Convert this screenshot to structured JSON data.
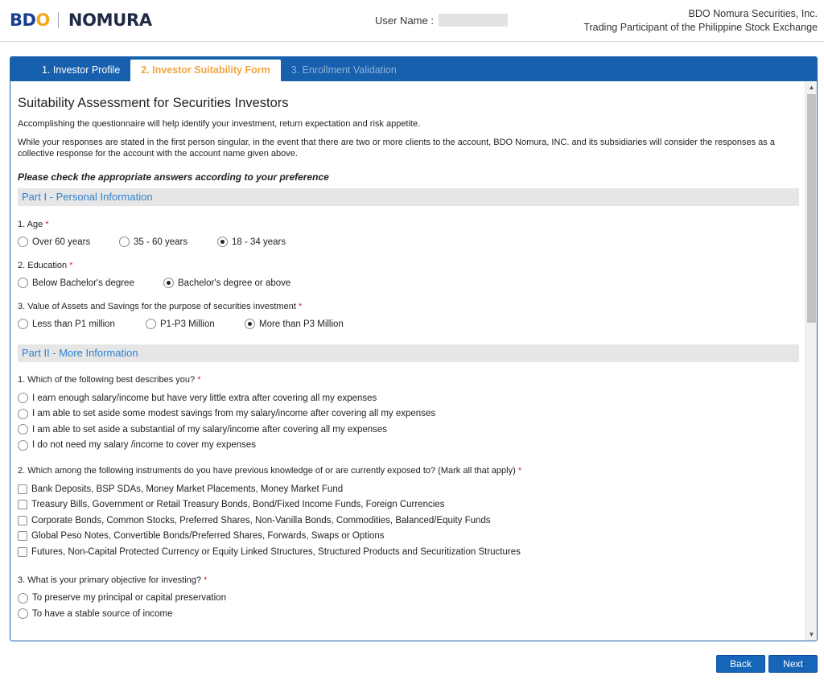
{
  "header": {
    "logo_bdo": "BDO",
    "logo_nomura": "NOMURA",
    "user_label": "User Name :",
    "company_line1": "BDO Nomura Securities, Inc.",
    "company_line2": "Trading Participant of the Philippine Stock Exchange"
  },
  "tabs": [
    {
      "label": "1. Investor Profile",
      "state": "normal"
    },
    {
      "label": "2. Investor Suitability Form",
      "state": "active"
    },
    {
      "label": "3. Enrollment Validation",
      "state": "disabled"
    }
  ],
  "form": {
    "title": "Suitability Assessment for Securities Investors",
    "intro1": "Accomplishing the questionnaire will help identify your investment, return expectation and risk appetite.",
    "intro2": "While your responses are stated in the first person singular, in the event that there are two or more clients to the account, BDO Nomura, INC. and its subsidiaries will consider the responses as a collective response for the account with the account name given above.",
    "instruction": "Please check the appropriate answers according to your preference",
    "required_mark": "*",
    "part1": {
      "heading": "Part I - Personal Information",
      "q1": {
        "label": "1. Age",
        "options": [
          "Over 60 years",
          "35 - 60 years",
          "18 - 34 years"
        ],
        "selected": 2
      },
      "q2": {
        "label": "2. Education",
        "options": [
          "Below Bachelor's degree",
          "Bachelor's degree or above"
        ],
        "selected": 1
      },
      "q3": {
        "label": "3. Value of Assets and Savings for the purpose of securities investment",
        "options": [
          "Less than P1 million",
          "P1-P3 Million",
          "More than P3 Million"
        ],
        "selected": 2
      }
    },
    "part2": {
      "heading": "Part II - More Information",
      "q1": {
        "label": "1. Which of the following best describes you?",
        "options": [
          "I earn enough salary/income but have very little extra after covering all my expenses",
          "I am able to set aside some modest savings from my salary/income after covering all my expenses",
          "I am able to set aside a substantial of my salary/income after covering all my expenses",
          "I do not need my salary /income to cover my expenses"
        ]
      },
      "q2": {
        "label": "2. Which among the following instruments do you have previous knowledge of or are currently exposed to? (Mark all that apply)",
        "options": [
          "Bank Deposits, BSP SDAs, Money Market Placements, Money Market Fund",
          "Treasury Bills, Government or Retail Treasury Bonds, Bond/Fixed Income Funds, Foreign Currencies",
          "Corporate Bonds, Common Stocks, Preferred Shares, Non-Vanilla Bonds, Commodities, Balanced/Equity Funds",
          "Global Peso Notes, Convertible Bonds/Preferred Shares, Forwards, Swaps or Options",
          "Futures, Non-Capital Protected Currency or Equity Linked Structures, Structured Products and Securitization Structures"
        ]
      },
      "q3": {
        "label": "3. What is your primary objective for investing?",
        "options": [
          "To preserve my principal or capital preservation",
          "To have a stable source of income"
        ]
      }
    }
  },
  "footer": {
    "back_label": "Back",
    "next_label": "Next"
  }
}
